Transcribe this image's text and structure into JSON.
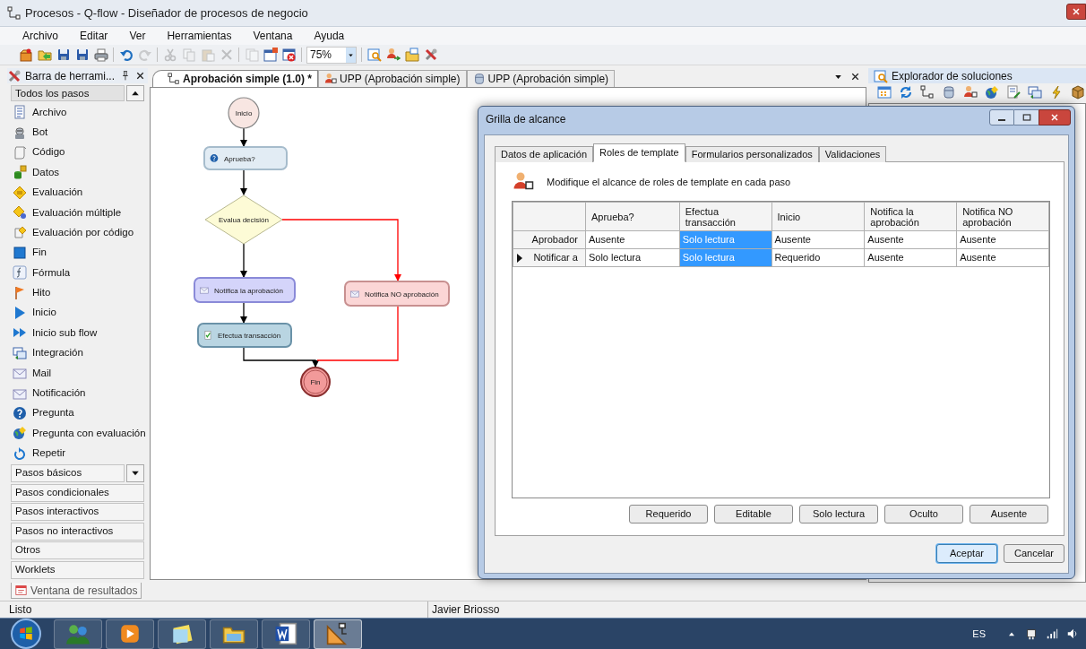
{
  "window": {
    "title": "Procesos - Q-flow - Diseñador de procesos de negocio"
  },
  "menu": [
    "Archivo",
    "Editar",
    "Ver",
    "Herramientas",
    "Ventana",
    "Ayuda"
  ],
  "toolbar": {
    "buttons": [
      {
        "disabled": false
      },
      {
        "disabled": false
      },
      {
        "disabled": false
      },
      {
        "disabled": false
      },
      {
        "disabled": false
      },
      {
        "disabled": false
      },
      {
        "disabled": true
      },
      {
        "disabled": true
      },
      {
        "disabled": true
      },
      {
        "disabled": true
      },
      {
        "disabled": true
      },
      {
        "disabled": true
      },
      {
        "disabled": false
      },
      {
        "disabled": false
      },
      {
        "disabled": false
      },
      {
        "disabled": false
      },
      {
        "disabled": false
      },
      {
        "disabled": false
      }
    ],
    "zoom": "75%"
  },
  "toolbox": {
    "title": "Barra de herrami...",
    "groups": [
      {
        "label": "Todos los pasos",
        "expanded": true,
        "items": [
          "Archivo",
          "Bot",
          "Código",
          "Datos",
          "Evaluación",
          "Evaluación múltiple",
          "Evaluación por código",
          "Fin",
          "Fórmula",
          "Hito",
          "Inicio",
          "Inicio sub flow",
          "Integración",
          "Mail",
          "Notificación",
          "Pregunta",
          "Pregunta con evaluación",
          "Repetir"
        ]
      },
      {
        "label": "Pasos básicos",
        "expanded": false
      },
      {
        "label": "Pasos condicionales",
        "expanded": false
      },
      {
        "label": "Pasos interactivos",
        "expanded": false
      },
      {
        "label": "Pasos no interactivos",
        "expanded": false
      },
      {
        "label": "Otros",
        "expanded": false
      },
      {
        "label": "Worklets",
        "expanded": false
      }
    ]
  },
  "document_tabs": [
    {
      "label": "Aprobación simple (1.0) *",
      "selected": true
    },
    {
      "label": "UPP (Aprobación simple)",
      "selected": false
    },
    {
      "label": "UPP (Aprobación simple)",
      "selected": false
    }
  ],
  "diagram": {
    "nodes": [
      {
        "kind": "start",
        "label": "Inicio",
        "color": "#f8e6e2"
      },
      {
        "kind": "question",
        "label": "Aprueba?",
        "color": "#e2ecf4"
      },
      {
        "kind": "decision",
        "label": "Evalua decisión",
        "color": "#fdfbd6"
      },
      {
        "kind": "notification",
        "label": "Notifica la aprobación",
        "color": "#d4d4fa"
      },
      {
        "kind": "task",
        "label": "Efectua transacción",
        "color": "#b9d5e2"
      },
      {
        "kind": "notification",
        "label": "Notifica NO aprobación",
        "color": "#fbd6d6"
      },
      {
        "kind": "end",
        "label": "Fin",
        "color": "#f29a9a"
      }
    ],
    "connectors": [
      {
        "kind": "default"
      },
      {
        "kind": "default"
      },
      {
        "kind": "default"
      },
      {
        "kind": "rejected"
      },
      {
        "kind": "default"
      },
      {
        "kind": "default"
      },
      {
        "kind": "rejected"
      }
    ]
  },
  "solution_explorer": {
    "title": "Explorador de soluciones"
  },
  "dialog": {
    "title": "Grilla de alcance",
    "tabs": [
      {
        "label": "Datos de aplicación",
        "selected": false
      },
      {
        "label": "Roles de template",
        "selected": true
      },
      {
        "label": "Formularios personalizados",
        "selected": false
      },
      {
        "label": "Validaciones",
        "selected": false
      }
    ],
    "description": "Modifique el alcance de roles de template en cada paso",
    "columns": [
      "Aprueba?",
      "Efectua transacción",
      "Inicio",
      "Notifica la aprobación",
      "Notifica NO aprobación"
    ],
    "rows": [
      {
        "header": "Aprobador",
        "current": false,
        "cells": [
          {
            "value": "Ausente",
            "selected": false
          },
          {
            "value": "Solo lectura",
            "selected": true
          },
          {
            "value": "Ausente",
            "selected": false
          },
          {
            "value": "Ausente",
            "selected": false
          },
          {
            "value": "Ausente",
            "selected": false
          }
        ]
      },
      {
        "header": "Notificar a",
        "current": true,
        "cells": [
          {
            "value": "Solo lectura",
            "selected": false
          },
          {
            "value": "Solo lectura",
            "selected": true
          },
          {
            "value": "Requerido",
            "selected": false
          },
          {
            "value": "Ausente",
            "selected": false
          },
          {
            "value": "Ausente",
            "selected": false
          }
        ]
      }
    ],
    "scope_buttons": [
      "Requerido",
      "Editable",
      "Solo lectura",
      "Oculto",
      "Ausente"
    ],
    "buttons": [
      {
        "label": "Aceptar",
        "focused": true
      },
      {
        "label": "Cancelar",
        "focused": false
      }
    ]
  },
  "results_tab": "Ventana de resultados",
  "status_bar": [
    "Listo",
    "Javier Briosso"
  ],
  "taskbar": {
    "apps": [
      {
        "selected": false
      },
      {
        "selected": false
      },
      {
        "selected": false
      },
      {
        "selected": false
      },
      {
        "selected": false
      },
      {
        "selected": true
      }
    ],
    "language": "ES"
  }
}
